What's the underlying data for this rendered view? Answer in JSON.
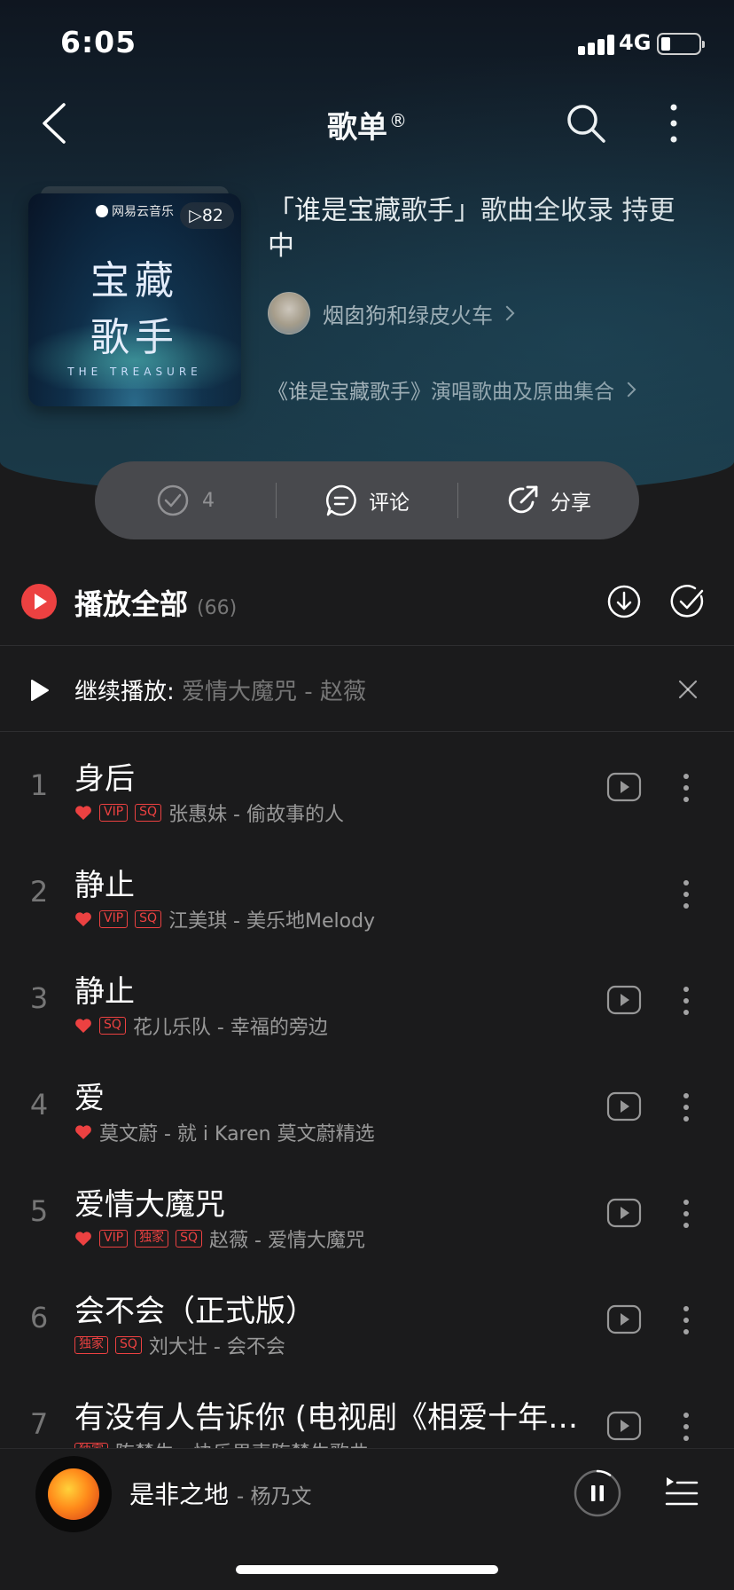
{
  "status_bar": {
    "time": "6:05",
    "network": "4G"
  },
  "nav": {
    "title": "歌单",
    "title_mark": "®"
  },
  "cover": {
    "logo": "网易云音乐",
    "play_count": "82",
    "title_line1": "宝藏",
    "title_line2": "歌手",
    "subtitle": "THE TREASURE"
  },
  "playlist": {
    "title": "「谁是宝藏歌手」歌曲全收录 持更中",
    "creator": "烟囱狗和绿皮火车",
    "description": "《谁是宝藏歌手》演唱歌曲及原曲集合"
  },
  "actions": {
    "collect_count": "4",
    "comment_label": "评论",
    "share_label": "分享"
  },
  "play_all": {
    "label": "播放全部",
    "count": "(66)"
  },
  "continue": {
    "label": "继续播放:",
    "song": "爱情大魔咒 - 赵薇"
  },
  "songs": [
    {
      "index": "1",
      "name": "身后",
      "meta": "张惠妹 - 偷故事的人",
      "liked": true,
      "tags": [
        "VIP",
        "SQ"
      ],
      "has_mv": true
    },
    {
      "index": "2",
      "name": "静止",
      "meta": "江美琪 - 美乐地Melody",
      "liked": true,
      "tags": [
        "VIP",
        "SQ"
      ],
      "has_mv": false
    },
    {
      "index": "3",
      "name": "静止",
      "meta": "花儿乐队 - 幸福的旁边",
      "liked": true,
      "tags": [
        "SQ"
      ],
      "has_mv": true
    },
    {
      "index": "4",
      "name": "爱",
      "meta": "莫文蔚 - 就 i Karen 莫文蔚精选",
      "liked": true,
      "tags": [],
      "has_mv": true
    },
    {
      "index": "5",
      "name": "爱情大魔咒",
      "meta": "赵薇 - 爱情大魔咒",
      "liked": true,
      "tags": [
        "VIP",
        "独家",
        "SQ"
      ],
      "has_mv": true
    },
    {
      "index": "6",
      "name": "会不会（正式版）",
      "meta": "刘大壮 - 会不会",
      "liked": false,
      "tags": [
        "独家",
        "SQ"
      ],
      "has_mv": true
    },
    {
      "index": "7",
      "name": "有没有人告诉你 (电视剧《相爱十年》插曲)",
      "meta": "陈楚生 - 快乐男声陈楚生歌曲",
      "liked": false,
      "tags": [
        "独家"
      ],
      "has_mv": true
    }
  ],
  "mini_player": {
    "title": "是非之地",
    "artist": "- 杨乃文"
  },
  "colors": {
    "accent": "#ec4141",
    "background": "#1b1b1c",
    "action_bar": "#48494d"
  }
}
